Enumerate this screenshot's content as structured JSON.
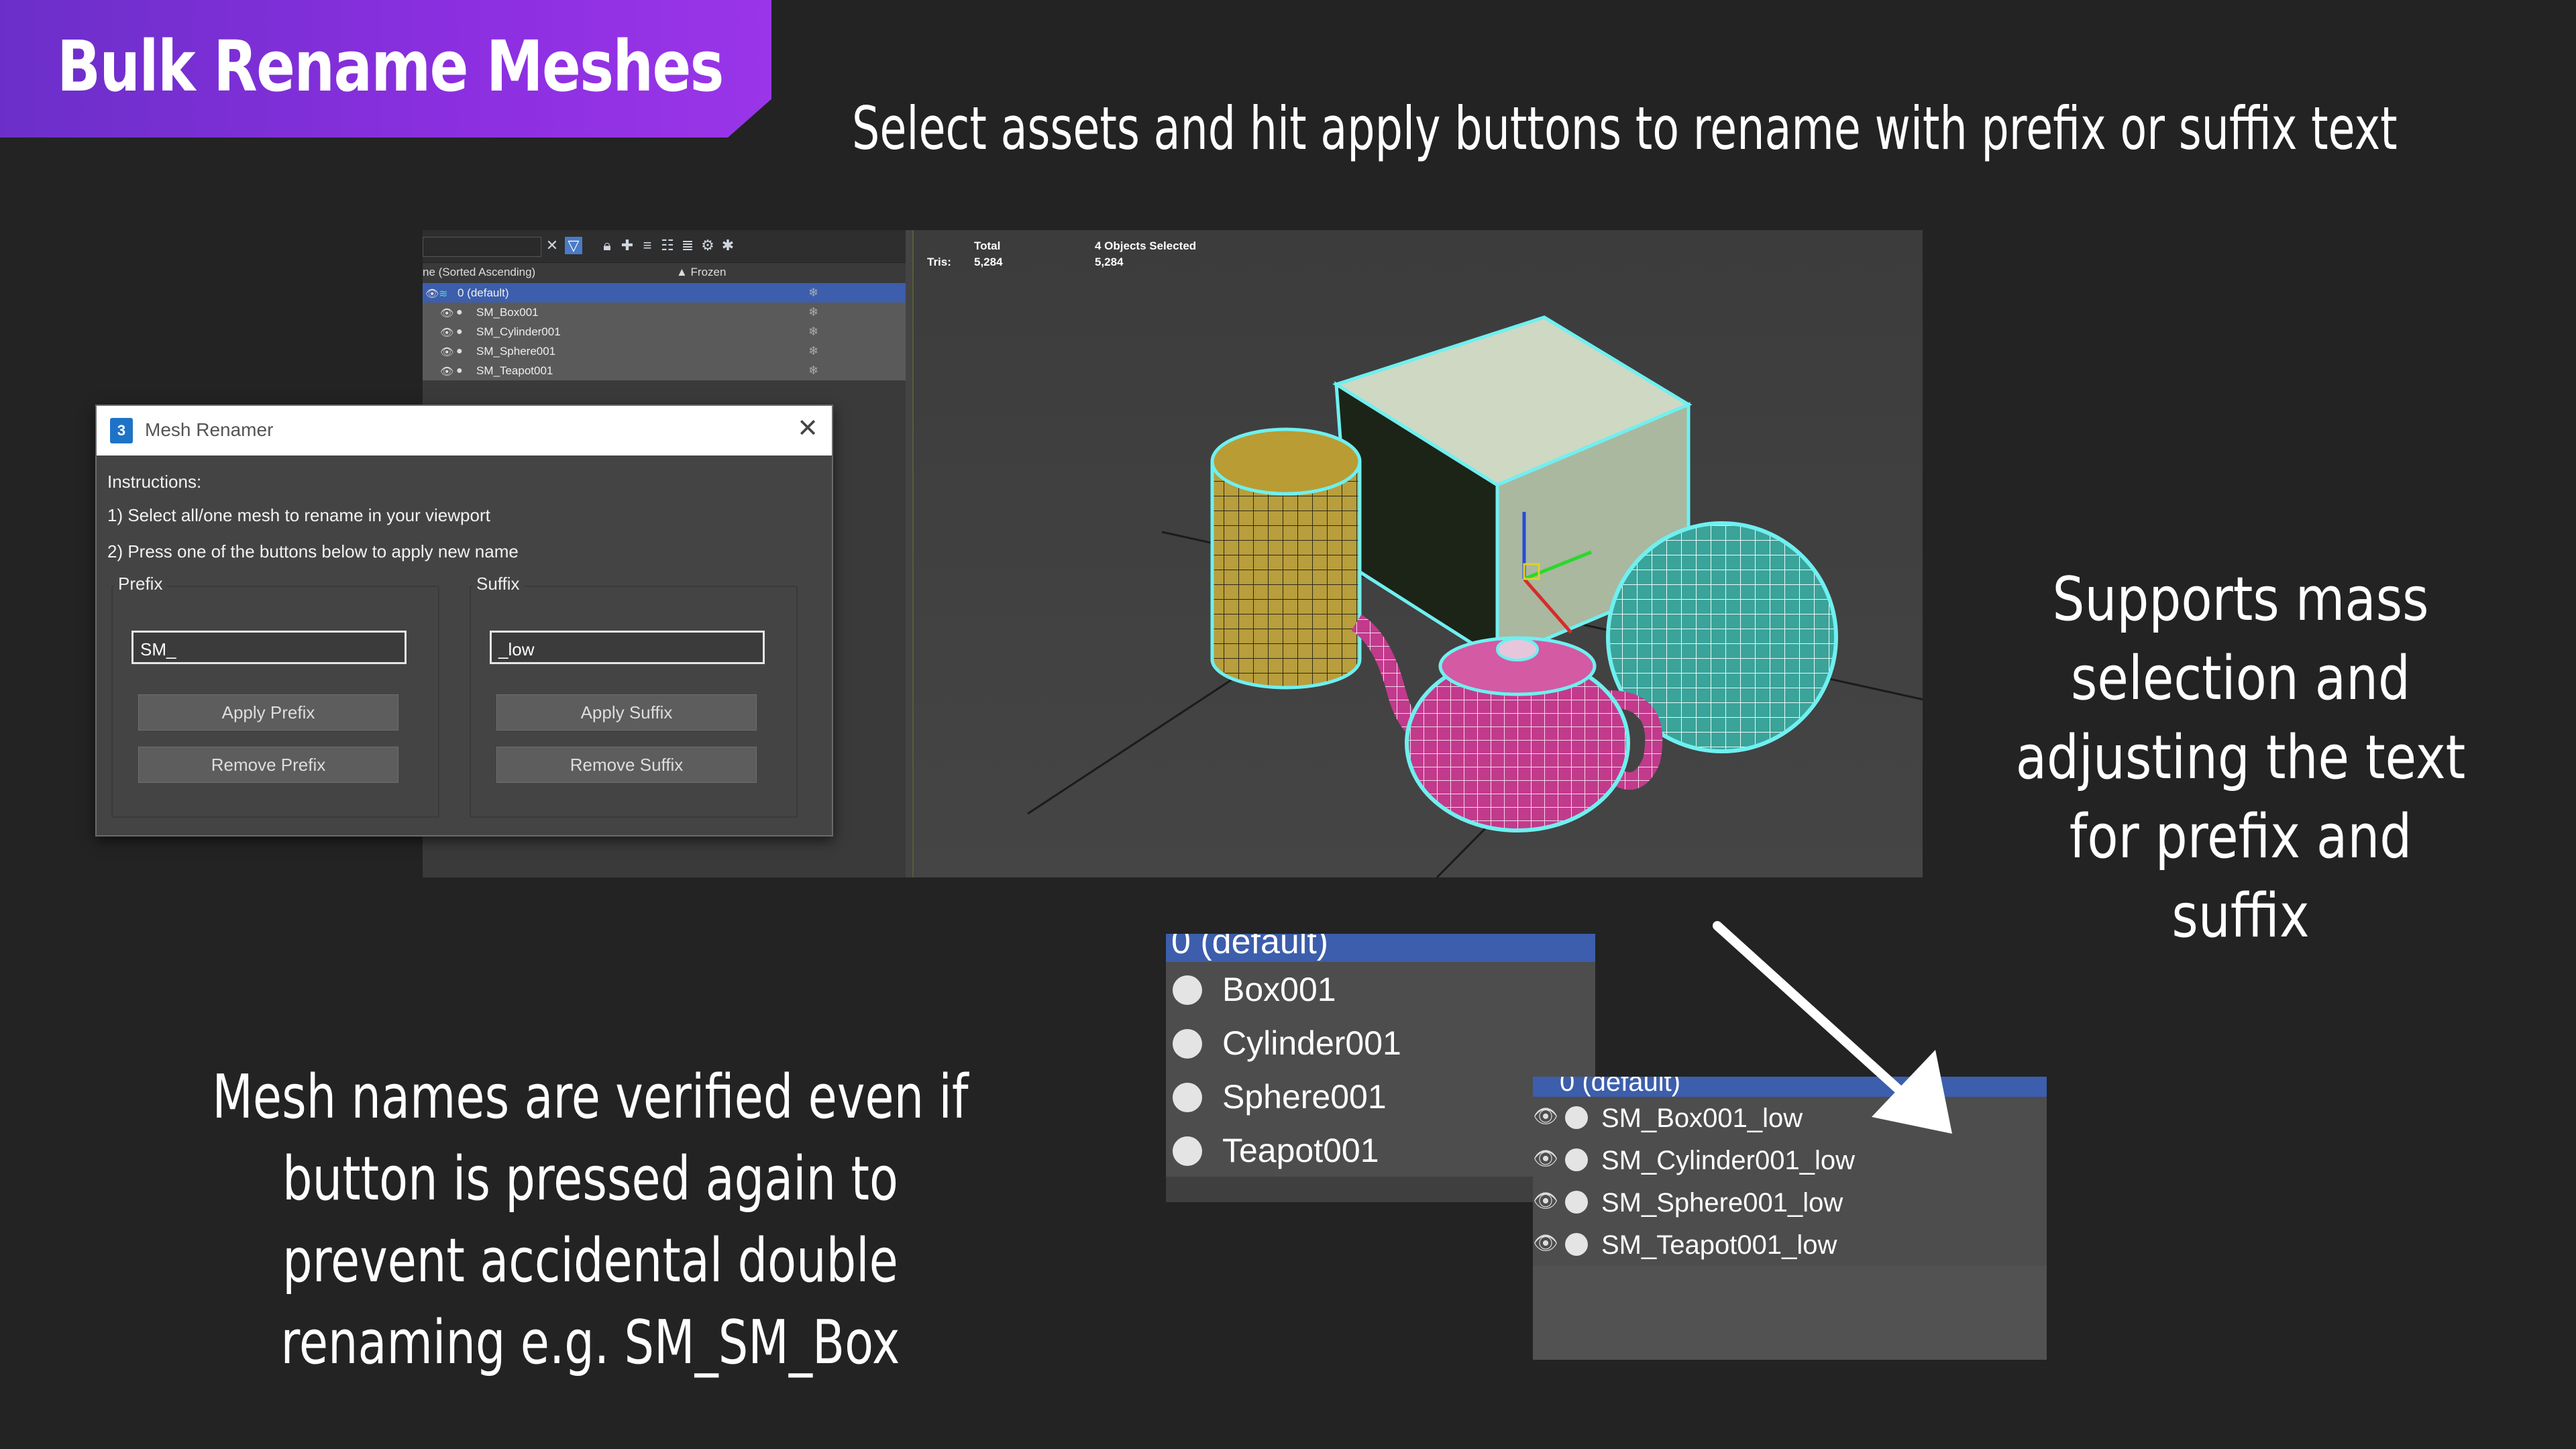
{
  "banner": {
    "title": "Bulk Rename Meshes"
  },
  "captions": {
    "top": "Select assets and hit apply buttons to rename with prefix or suffix text",
    "right": "Supports mass selection and adjusting the text for prefix and suffix",
    "bottom": "Mesh names are verified even if button is pressed again to prevent accidental double renaming e.g. SM_SM_Box"
  },
  "scene_explorer": {
    "column_name": "ne (Sorted Ascending)",
    "column_frozen": "▲ Frozen",
    "layer": "0 (default)",
    "items": [
      "SM_Box001",
      "SM_Cylinder001",
      "SM_Sphere001",
      "SM_Teapot001"
    ]
  },
  "viewport": {
    "total_label": "Total",
    "selected_label": "4 Objects Selected",
    "tris_label": "Tris:",
    "tris_total": "5,284",
    "tris_selected": "5,284"
  },
  "dialog": {
    "title": "Mesh Renamer",
    "icon_text": "3",
    "instructions_heading": "Instructions:",
    "instruction_1": "1) Select all/one mesh to rename in your viewport",
    "instruction_2": "2) Press one of the buttons below to apply new name",
    "prefix_group": "Prefix",
    "suffix_group": "Suffix",
    "prefix_value": "SM_",
    "suffix_value": "_low",
    "apply_prefix": "Apply Prefix",
    "remove_prefix": "Remove Prefix",
    "apply_suffix": "Apply Suffix",
    "remove_suffix": "Remove Suffix",
    "close_glyph": "✕"
  },
  "before_outliner": {
    "layer": "0 (default)",
    "items": [
      "Box001",
      "Cylinder001",
      "Sphere001",
      "Teapot001"
    ]
  },
  "after_outliner": {
    "layer": "0 (default)",
    "items": [
      "SM_Box001_low",
      "SM_Cylinder001_low",
      "SM_Sphere001_low",
      "SM_Teapot001_low"
    ]
  },
  "colors": {
    "banner": "#8b2fe0",
    "selection_blue": "#3c5eac",
    "wire_cyan": "#6ff0f0"
  }
}
